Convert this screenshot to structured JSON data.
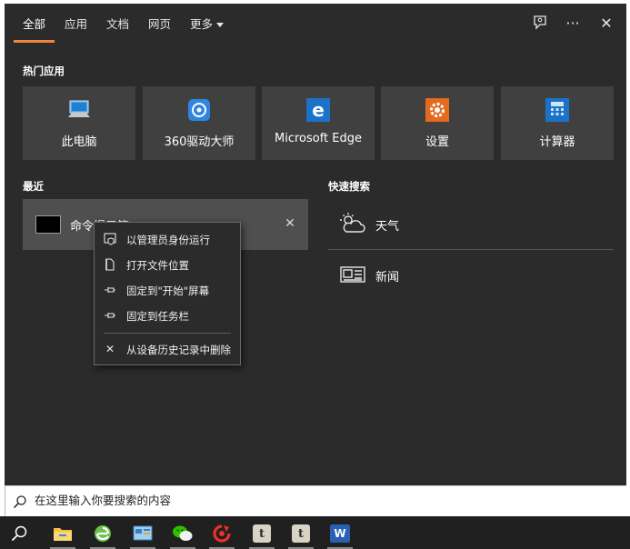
{
  "header": {
    "tabs": [
      {
        "label": "全部",
        "active": true
      },
      {
        "label": "应用",
        "active": false
      },
      {
        "label": "文档",
        "active": false
      },
      {
        "label": "网页",
        "active": false
      },
      {
        "label": "更多",
        "active": false,
        "has_dropdown": true
      }
    ],
    "icons": [
      "feedback-icon",
      "more-icon",
      "close-icon"
    ],
    "more_glyph": "···",
    "close_glyph": "✕",
    "accent_color": "#f0843c"
  },
  "top_apps": {
    "title": "热门应用",
    "items": [
      {
        "label": "此电脑",
        "icon": "this-pc-icon"
      },
      {
        "label": "360驱动大师",
        "icon": "360-driver-icon"
      },
      {
        "label": "Microsoft Edge",
        "icon": "edge-icon"
      },
      {
        "label": "设置",
        "icon": "settings-gear-icon"
      },
      {
        "label": "计算器",
        "icon": "calculator-icon"
      }
    ]
  },
  "recent": {
    "title": "最近",
    "items": [
      {
        "label": "命令提示符",
        "icon": "command-prompt-icon",
        "close_glyph": "✕"
      }
    ]
  },
  "context_menu": {
    "items": [
      {
        "label": "以管理员身份运行",
        "icon": "run-as-admin-icon"
      },
      {
        "label": "打开文件位置",
        "icon": "open-file-location-icon"
      },
      {
        "label": "固定到\"开始\"屏幕",
        "icon": "pin-icon"
      },
      {
        "label": "固定到任务栏",
        "icon": "pin-icon"
      },
      {
        "label": "从设备历史记录中删除",
        "icon": "close-icon",
        "close_glyph": "✕"
      }
    ]
  },
  "quick_search": {
    "title": "快速搜索",
    "items": [
      {
        "label": "天气",
        "icon": "weather-icon"
      },
      {
        "label": "新闻",
        "icon": "news-icon"
      }
    ]
  },
  "search": {
    "placeholder": "在这里输入你要搜索的内容",
    "value": ""
  },
  "taskbar": {
    "apps": [
      "file-explorer-icon",
      "ie-browser-icon",
      "control-panel-icon",
      "wechat-icon",
      "360-browser-icon",
      "tumblr-icon",
      "tumblr-icon",
      "word-icon"
    ],
    "t_glyph": "t",
    "word_glyph": "W"
  }
}
